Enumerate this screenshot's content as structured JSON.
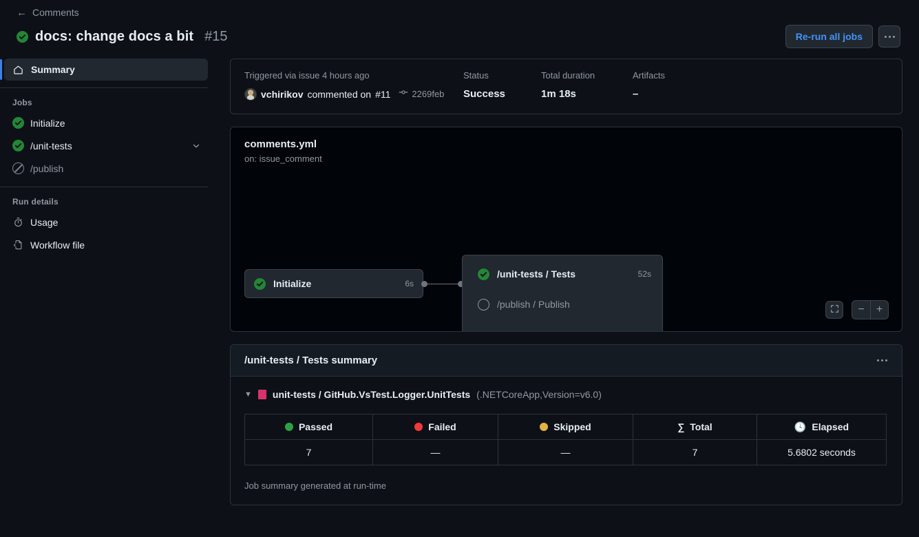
{
  "header": {
    "back_label": "Comments",
    "back_icon": "arrow-left-icon",
    "status_icon": "check-circle-success-icon",
    "run_title": "docs: change docs a bit",
    "run_number": "#15",
    "rerun_button": "Re-run all jobs",
    "more_menu_icon": "kebab-horizontal-icon"
  },
  "sidebar": {
    "summary_label": "Summary",
    "summary_icon": "home-icon",
    "jobs_heading": "Jobs",
    "jobs": [
      {
        "label": "Initialize",
        "status": "success",
        "expandable": false
      },
      {
        "label": "/unit-tests",
        "status": "success",
        "expandable": true
      },
      {
        "label": "/publish",
        "status": "skipped",
        "expandable": false
      }
    ],
    "run_details_heading": "Run details",
    "run_details": [
      {
        "label": "Usage",
        "icon": "stopwatch-icon"
      },
      {
        "label": "Workflow file",
        "icon": "file-code-icon"
      }
    ]
  },
  "info": {
    "triggered_label": "Triggered via issue 4 hours ago",
    "actor": "vchirikov",
    "action_text": "commented on",
    "issue_ref": "#11",
    "commit_icon": "git-commit-icon",
    "commit_sha": "2269feb",
    "status_label": "Status",
    "status_value": "Success",
    "duration_label": "Total duration",
    "duration_value": "1m 18s",
    "artifacts_label": "Artifacts",
    "artifacts_value": "–"
  },
  "graph": {
    "workflow_file": "comments.yml",
    "trigger": "on: issue_comment",
    "nodes": [
      {
        "label": "Initialize",
        "time": "6s",
        "status": "success"
      }
    ],
    "group_nodes": [
      {
        "label": "/unit-tests / Tests",
        "time": "52s",
        "status": "success"
      },
      {
        "label": "/publish / Publish",
        "time": "",
        "status": "pending"
      }
    ],
    "controls": {
      "fit_icon": "fit-screen-icon",
      "zoom_out": "−",
      "zoom_in": "+"
    }
  },
  "summary": {
    "title": "/unit-tests / Tests summary",
    "menu_icon": "kebab-horizontal-icon",
    "tree": {
      "caret": "▼",
      "name": "unit-tests / GitHub.VsTest.Logger.UnitTests",
      "meta": "(.NETCoreApp,Version=v6.0)",
      "marker_color": "#d6336c"
    },
    "table": {
      "columns": [
        {
          "label": "Passed",
          "icon": "green-dot-icon",
          "color": "#2ea043"
        },
        {
          "label": "Failed",
          "icon": "red-dot-icon",
          "color": "#f03a3a"
        },
        {
          "label": "Skipped",
          "icon": "yellow-dot-icon",
          "color": "#e3b341"
        },
        {
          "label": "Total",
          "icon": "sigma-icon",
          "glyph": "∑"
        },
        {
          "label": "Elapsed",
          "icon": "clock-icon",
          "glyph": "🕓"
        }
      ],
      "rows": [
        [
          "7",
          "—",
          "—",
          "7",
          "5.6802 seconds"
        ]
      ]
    },
    "footer_note": "Job summary generated at run-time"
  }
}
